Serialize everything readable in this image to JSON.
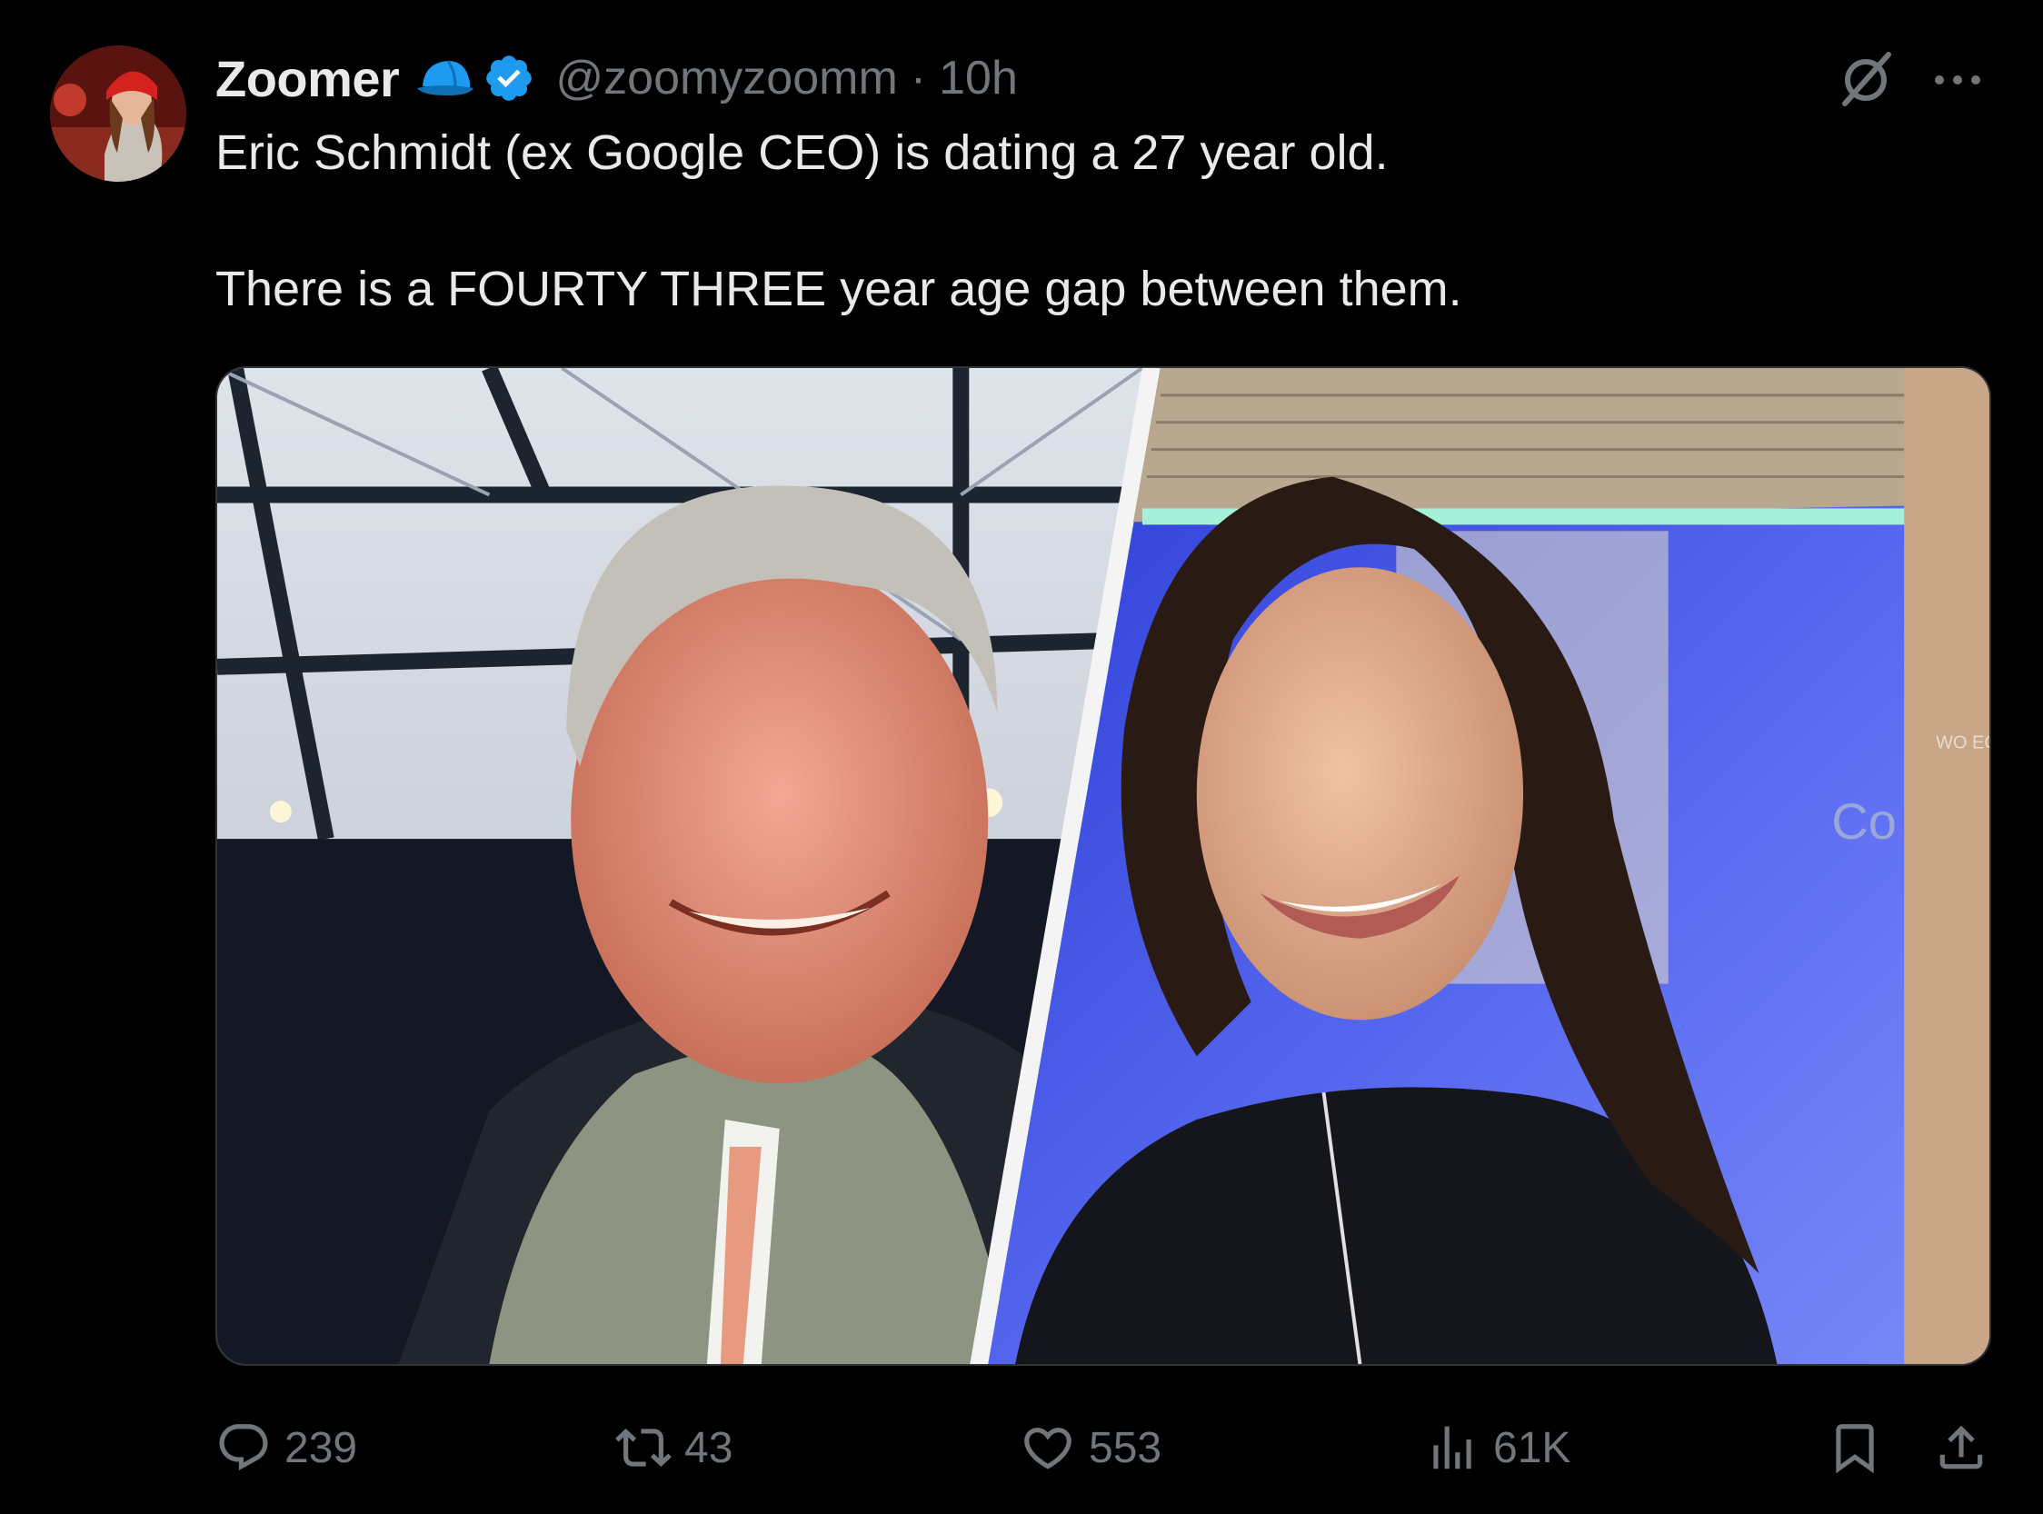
{
  "tweet": {
    "author": {
      "display_name": "Zoomer",
      "handle": "@zoomyzoomm",
      "separator": "·",
      "time": "10h",
      "verified": true,
      "avatar_icon": "avatar-photo"
    },
    "text": {
      "line1": "Eric Schmidt (ex Google CEO) is dating a 27 year old.",
      "line2": "There is a FOURTY THREE year age gap between them."
    },
    "media": {
      "left_sign_text": "",
      "right_sign_text": "Co",
      "right_sign_text2": "WO ECO FO"
    },
    "stats": {
      "replies": "239",
      "retweets": "43",
      "likes": "553",
      "views": "61K"
    }
  },
  "colors": {
    "background": "#000000",
    "text_primary": "#e7e9ea",
    "text_secondary": "#71767b",
    "verified_blue": "#1d9bf0",
    "border": "#2f3336"
  }
}
